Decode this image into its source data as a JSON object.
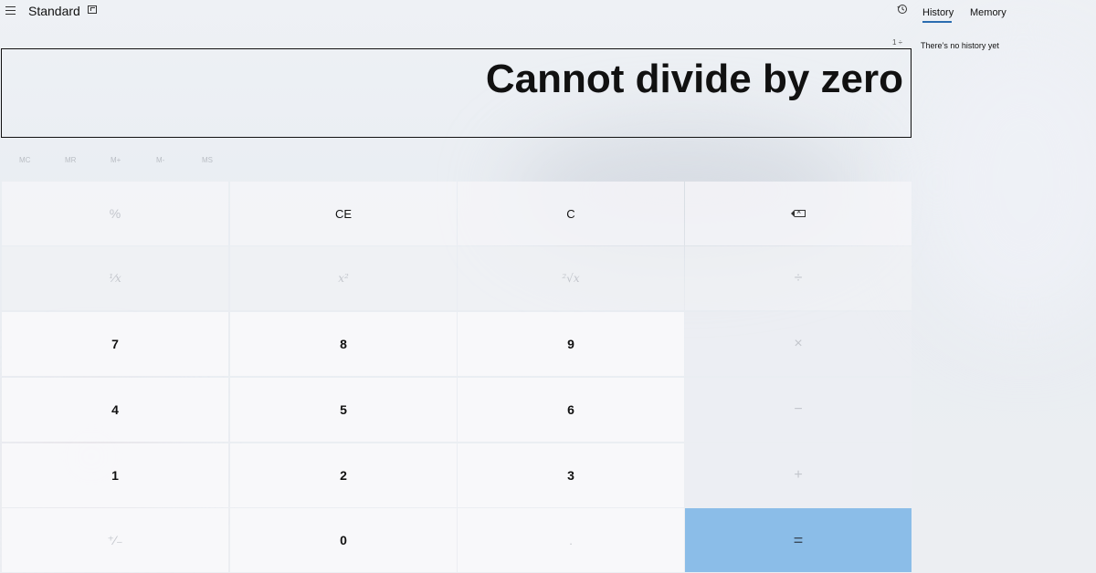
{
  "header": {
    "mode_title": "Standard",
    "menu_icon": "hamburger-icon",
    "keep_on_top_icon": "keep-on-top-icon",
    "history_icon": "history-icon"
  },
  "side_panel": {
    "tabs": [
      {
        "label": "History",
        "selected": true
      },
      {
        "label": "Memory",
        "selected": false
      }
    ],
    "expression": "1 ÷",
    "empty_message": "There’s no history yet",
    "accent": "#2b6cb0"
  },
  "display": {
    "value": "Cannot divide by zero"
  },
  "memory_buttons": [
    "MC",
    "MR",
    "M+",
    "M-",
    "MS"
  ],
  "keys": {
    "percent": "%",
    "ce": "CE",
    "c": "C",
    "backspace": "backspace-icon",
    "reciprocal": "¹⁄x",
    "square": "x²",
    "sqrt": "²√x",
    "divide": "÷",
    "seven": "7",
    "eight": "8",
    "nine": "9",
    "multiply": "×",
    "four": "4",
    "five": "5",
    "six": "6",
    "minus": "−",
    "one": "1",
    "two": "2",
    "three": "3",
    "plus": "+",
    "negate": "⁺⁄₋",
    "zero": "0",
    "decimal": ".",
    "equals": "="
  },
  "colors": {
    "equals_bg": "#8bbde8"
  }
}
